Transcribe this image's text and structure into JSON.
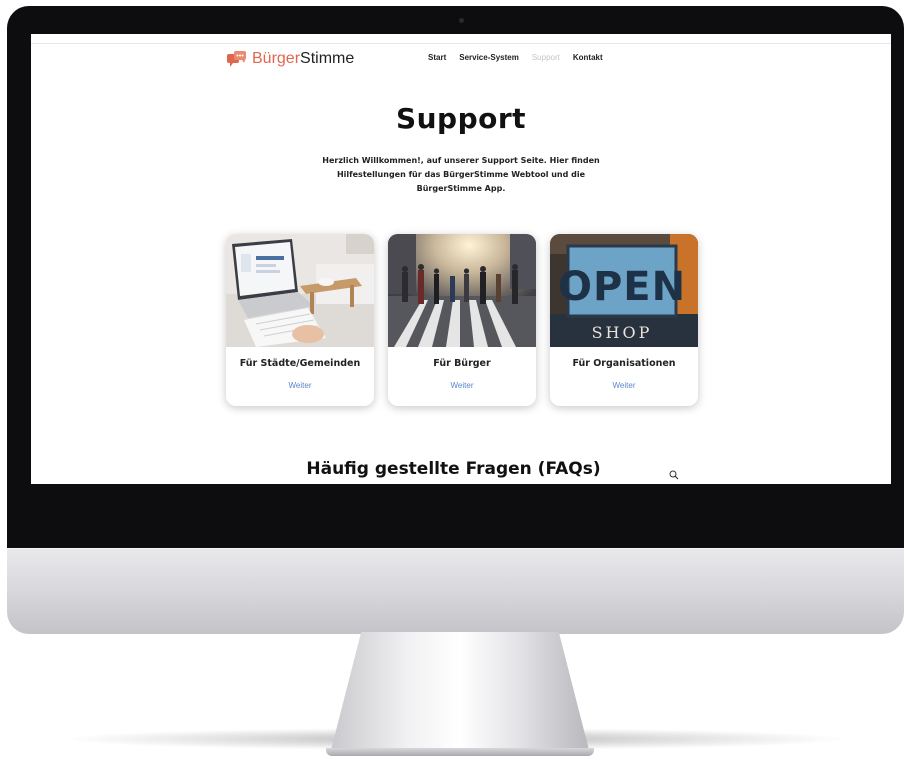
{
  "brand": {
    "name_part1": "Bürger",
    "name_part2": "Stimme",
    "accent_color": "#e0674d"
  },
  "nav": {
    "items": [
      {
        "label": "Start",
        "active": false
      },
      {
        "label": "Service-System",
        "active": false
      },
      {
        "label": "Support",
        "active": true
      },
      {
        "label": "Kontakt",
        "active": false
      }
    ]
  },
  "hero": {
    "title": "Support",
    "intro": "Herzlich Willkommen!, auf unserer Support Seite. Hier finden Hilfestellungen für das BürgerStimme Webtool und die BürgerStimme App."
  },
  "cards": [
    {
      "title": "Für Städte/Gemeinden",
      "link": "Weiter",
      "image": "laptop-desk-photo"
    },
    {
      "title": "Für Bürger",
      "link": "Weiter",
      "image": "crosswalk-crowd-photo"
    },
    {
      "title": "Für Organisationen",
      "link": "Weiter",
      "image": "open-shop-sign-photo",
      "image_text": {
        "big": "OPEN",
        "small": "SHOP"
      }
    }
  ],
  "faq": {
    "title": "Häufig gestellte Fragen (FAQs)",
    "search_icon": "search-icon"
  },
  "link_color": "#5a86c8"
}
